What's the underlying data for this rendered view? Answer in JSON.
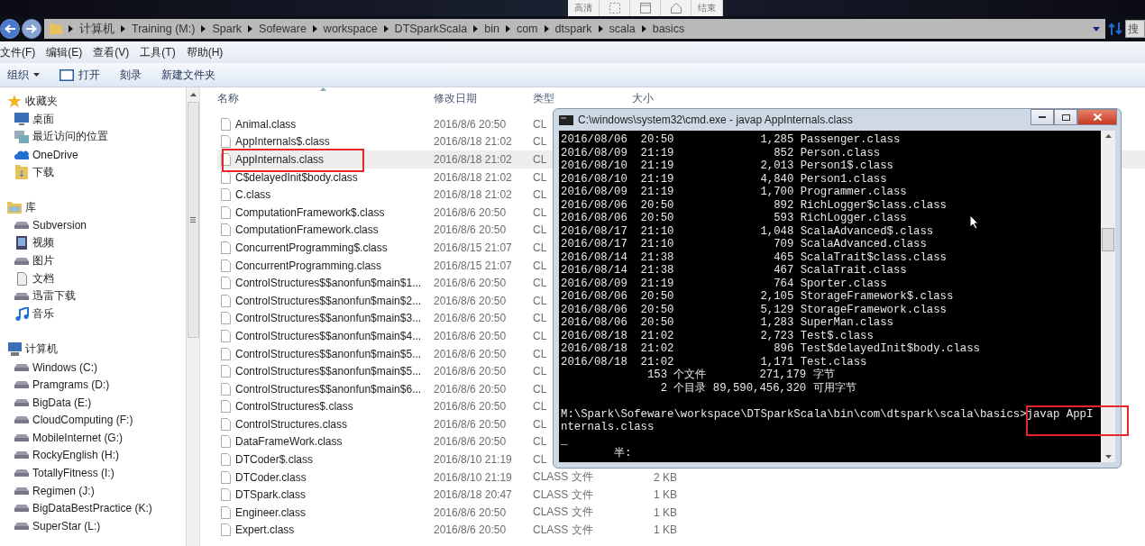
{
  "recorder_toolbar": {
    "items": [
      {
        "kind": "text",
        "label": "高清"
      },
      {
        "kind": "region"
      },
      {
        "kind": "window"
      },
      {
        "kind": "pin"
      },
      {
        "kind": "text",
        "label": "结束"
      }
    ]
  },
  "address_bar": {
    "crumbs": [
      "计算机",
      "Training (M:)",
      "Spark",
      "Sofeware",
      "workspace",
      "DTSparkScala",
      "bin",
      "com",
      "dtspark",
      "scala",
      "basics"
    ],
    "search_placeholder": "搜"
  },
  "menu_bar": [
    "文件(F)",
    "编辑(E)",
    "查看(V)",
    "工具(T)",
    "帮助(H)"
  ],
  "toolbar": [
    {
      "label": "组织",
      "kind": "dropdown"
    },
    {
      "label": "打开",
      "kind": "open"
    },
    {
      "label": "刻录",
      "kind": "plain"
    },
    {
      "label": "新建文件夹",
      "kind": "plain"
    }
  ],
  "sidebar": {
    "sections": [
      {
        "label": "收藏夹",
        "items": [
          "桌面",
          "最近访问的位置",
          "OneDrive",
          "下载"
        ]
      },
      {
        "label": "库",
        "items": [
          "Subversion",
          "视频",
          "图片",
          "文档",
          "迅雷下载",
          "音乐"
        ]
      },
      {
        "label": "计算机",
        "items": [
          "Windows (C:)",
          "Pramgrams (D:)",
          "BigData (E:)",
          "CloudComputing (F:)",
          "MobileInternet (G:)",
          "RockyEnglish (H:)",
          "TotallyFitness (I:)",
          "Regimen (J:)",
          "BigDataBestPractice (K:)",
          "SuperStar (L:)"
        ]
      }
    ]
  },
  "file_list": {
    "columns": [
      "名称",
      "修改日期",
      "类型",
      "大小"
    ],
    "rows": [
      {
        "name": "Animal.class",
        "date": "2016/8/6 20:50",
        "type": "CL",
        "selected": false
      },
      {
        "name": "AppInternals$.class",
        "date": "2016/8/18 21:02",
        "type": "CL",
        "selected": false
      },
      {
        "name": "AppInternals.class",
        "date": "2016/8/18 21:02",
        "type": "CL",
        "selected": true
      },
      {
        "name": "C$delayedInit$body.class",
        "date": "2016/8/18 21:02",
        "type": "CL",
        "selected": false
      },
      {
        "name": "C.class",
        "date": "2016/8/18 21:02",
        "type": "CL",
        "selected": false
      },
      {
        "name": "ComputationFramework$.class",
        "date": "2016/8/6 20:50",
        "type": "CL",
        "selected": false
      },
      {
        "name": "ComputationFramework.class",
        "date": "2016/8/6 20:50",
        "type": "CL",
        "selected": false
      },
      {
        "name": "ConcurrentProgramming$.class",
        "date": "2016/8/15 21:07",
        "type": "CL",
        "selected": false
      },
      {
        "name": "ConcurrentProgramming.class",
        "date": "2016/8/15 21:07",
        "type": "CL",
        "selected": false
      },
      {
        "name": "ControlStructures$$anonfun$main$1...",
        "date": "2016/8/6 20:50",
        "type": "CL",
        "selected": false
      },
      {
        "name": "ControlStructures$$anonfun$main$2...",
        "date": "2016/8/6 20:50",
        "type": "CL",
        "selected": false
      },
      {
        "name": "ControlStructures$$anonfun$main$3...",
        "date": "2016/8/6 20:50",
        "type": "CL",
        "selected": false
      },
      {
        "name": "ControlStructures$$anonfun$main$4...",
        "date": "2016/8/6 20:50",
        "type": "CL",
        "selected": false
      },
      {
        "name": "ControlStructures$$anonfun$main$5...",
        "date": "2016/8/6 20:50",
        "type": "CL",
        "selected": false
      },
      {
        "name": "ControlStructures$$anonfun$main$5...",
        "date": "2016/8/6 20:50",
        "type": "CL",
        "selected": false
      },
      {
        "name": "ControlStructures$$anonfun$main$6...",
        "date": "2016/8/6 20:50",
        "type": "CL",
        "selected": false
      },
      {
        "name": "ControlStructures$.class",
        "date": "2016/8/6 20:50",
        "type": "CL",
        "selected": false
      },
      {
        "name": "ControlStructures.class",
        "date": "2016/8/6 20:50",
        "type": "CL",
        "selected": false
      },
      {
        "name": "DataFrameWork.class",
        "date": "2016/8/6 20:50",
        "type": "CL",
        "selected": false
      },
      {
        "name": "DTCoder$.class",
        "date": "2016/8/10 21:19",
        "type": "CL",
        "selected": false
      },
      {
        "name": "DTCoder.class",
        "date": "2016/8/10 21:19",
        "type": "CLASS 文件",
        "size": "2 KB",
        "selected": false
      },
      {
        "name": "DTSpark.class",
        "date": "2016/8/18 20:47",
        "type": "CLASS 文件",
        "size": "1 KB",
        "selected": false
      },
      {
        "name": "Engineer.class",
        "date": "2016/8/6 20:50",
        "type": "CLASS 文件",
        "size": "1 KB",
        "selected": false
      },
      {
        "name": "Expert.class",
        "date": "2016/8/6 20:50",
        "type": "CLASS 文件",
        "size": "1 KB",
        "selected": false
      }
    ]
  },
  "cmd_window": {
    "title": "C:\\windows\\system32\\cmd.exe - javap  AppInternals.class",
    "listing": [
      "2016/08/06  20:50             1,285 Passenger.class",
      "2016/08/09  21:19               852 Person.class",
      "2016/08/10  21:19             2,013 Person1$.class",
      "2016/08/10  21:19             4,840 Person1.class",
      "2016/08/09  21:19             1,700 Programmer.class",
      "2016/08/06  20:50               892 RichLogger$class.class",
      "2016/08/06  20:50               593 RichLogger.class",
      "2016/08/17  21:10             1,048 ScalaAdvanced$.class",
      "2016/08/17  21:10               709 ScalaAdvanced.class",
      "2016/08/14  21:38               465 ScalaTrait$class.class",
      "2016/08/14  21:38               467 ScalaTrait.class",
      "2016/08/09  21:19               764 Sporter.class",
      "2016/08/06  20:50             2,105 StorageFramework$.class",
      "2016/08/06  20:50             5,129 StorageFramework.class",
      "2016/08/06  20:50             1,283 SuperMan.class",
      "2016/08/18  21:02             2,723 Test$.class",
      "2016/08/18  21:02               896 Test$delayedInit$body.class",
      "2016/08/18  21:02             1,171 Test.class",
      "             153 个文件        271,179 字节",
      "               2 个目录 89,590,456,320 可用字节"
    ],
    "prompt": [
      "M:\\Spark\\Sofeware\\workspace\\DTSparkScala\\bin\\com\\dtspark\\scala\\basics>javap AppI",
      "nternals.class",
      "_",
      "        半:"
    ]
  }
}
